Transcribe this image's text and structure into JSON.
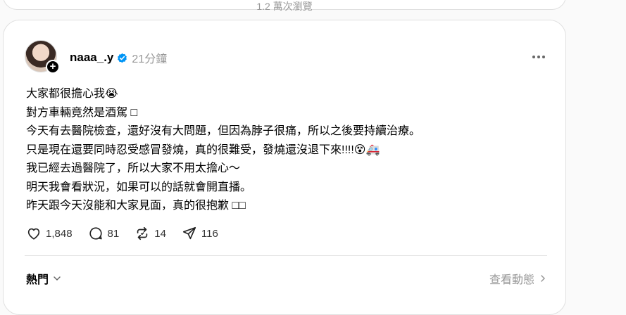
{
  "top_post": {
    "views": "1.2 萬次瀏覽"
  },
  "post": {
    "username": "naaa_.y",
    "time": "21分鐘",
    "lines": [
      "大家都很擔心我😭",
      "對方車輛竟然是酒駕 □",
      "今天有去醫院檢查，還好沒有大問題，但因為脖子很痛，所以之後要持續治療。",
      "只是現在還要同時忍受感冒發燒，真的很難受，發燒還沒退下來!!!!😵🚑",
      "我已經去過醫院了，所以大家不用太擔心～",
      "明天我會看狀況，如果可以的話就會開直播。",
      "昨天跟今天沒能和大家見面，真的很抱歉 □□"
    ],
    "likes": "1,848",
    "comments": "81",
    "reposts": "14",
    "shares": "116"
  },
  "footer": {
    "sort_label": "熱門",
    "activity_label": "查看動態"
  },
  "icons": {
    "verified": "verified-badge-icon",
    "more": "more-horizontal-icon",
    "like": "heart-icon",
    "comment": "comment-bubble-icon",
    "repost": "repost-icon",
    "share": "send-icon"
  },
  "colors": {
    "verified": "#0095f6",
    "muted": "#999999",
    "accent": "#000000"
  }
}
